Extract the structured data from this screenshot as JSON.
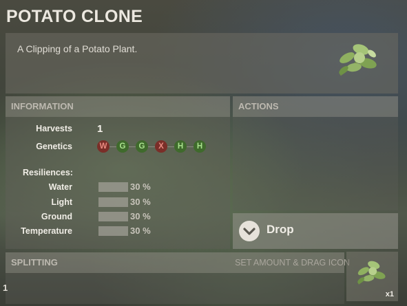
{
  "item": {
    "title": "POTATO CLONE",
    "description": "A Clipping of a Potato Plant."
  },
  "information": {
    "header": "INFORMATION",
    "harvests_label": "Harvests",
    "harvests_value": "1",
    "genetics_label": "Genetics",
    "genes": [
      {
        "letter": "W",
        "type": "bad"
      },
      {
        "letter": "G",
        "type": "good"
      },
      {
        "letter": "G",
        "type": "good"
      },
      {
        "letter": "X",
        "type": "bad"
      },
      {
        "letter": "H",
        "type": "good"
      },
      {
        "letter": "H",
        "type": "good"
      }
    ],
    "resiliences_label": "Resiliences:",
    "resiliences": [
      {
        "label": "Water",
        "value": "30 %",
        "fraction": 0.3
      },
      {
        "label": "Light",
        "value": "30 %",
        "fraction": 0.3
      },
      {
        "label": "Ground",
        "value": "30 %",
        "fraction": 0.3
      },
      {
        "label": "Temperature",
        "value": "30 %",
        "fraction": 0.3
      }
    ]
  },
  "actions": {
    "header": "ACTIONS",
    "drop_label": "Drop"
  },
  "splitting": {
    "header": "SPLITTING",
    "hint": "SET AMOUNT & DRAG ICON",
    "amount": "1",
    "slot_count": "x1"
  },
  "colors": {
    "gene_bad": "#7a2e28",
    "gene_good": "#3f6a2c"
  }
}
